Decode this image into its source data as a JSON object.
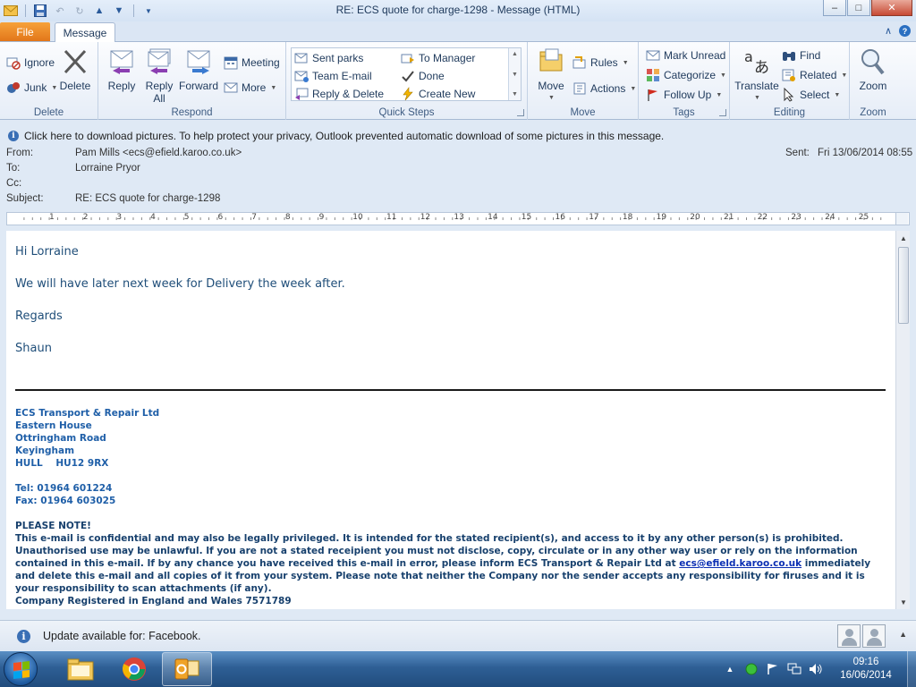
{
  "window": {
    "title": "RE: ECS quote for charge-1298  -  Message (HTML)"
  },
  "tabs": {
    "file": "File",
    "message": "Message"
  },
  "ribbon": {
    "delete_group": {
      "label": "Delete",
      "ignore": "Ignore",
      "junk": "Junk",
      "delete": "Delete"
    },
    "respond_group": {
      "label": "Respond",
      "reply": "Reply",
      "reply_all": "Reply All",
      "reply_all_line1": "Reply",
      "reply_all_line2": "All",
      "forward": "Forward",
      "meeting": "Meeting",
      "more": "More"
    },
    "quick_steps": {
      "label": "Quick Steps",
      "items": [
        "Sent parks",
        "To Manager",
        "Team E-mail",
        "Done",
        "Reply & Delete",
        "Create New"
      ]
    },
    "move_group": {
      "label": "Move",
      "move": "Move",
      "rules": "Rules",
      "actions": "Actions"
    },
    "tags_group": {
      "label": "Tags",
      "mark_unread": "Mark Unread",
      "categorize": "Categorize",
      "follow_up": "Follow Up"
    },
    "editing_group": {
      "label": "Editing",
      "translate": "Translate",
      "find": "Find",
      "related": "Related",
      "select": "Select"
    },
    "zoom_group": {
      "label": "Zoom",
      "zoom": "Zoom"
    }
  },
  "infobar": {
    "text": "Click here to download pictures. To help protect your privacy, Outlook prevented automatic download of some pictures in this message."
  },
  "header": {
    "from_label": "From:",
    "from_value": "Pam Mills <ecs@efield.karoo.co.uk>",
    "to_label": "To:",
    "to_value": "Lorraine Pryor",
    "cc_label": "Cc:",
    "cc_value": "",
    "subject_label": "Subject:",
    "subject_value": "RE: ECS quote for charge-1298",
    "sent_label": "Sent:",
    "sent_value": "Fri 13/06/2014 08:55"
  },
  "ruler": {
    "numbers": [
      "1",
      "2",
      "3",
      "4",
      "5",
      "6",
      "7",
      "8",
      "9",
      "10",
      "11",
      "12",
      "13",
      "14",
      "15",
      "16",
      "17",
      "18",
      "19",
      "20",
      "21",
      "22",
      "23",
      "24",
      "25"
    ]
  },
  "body": {
    "greeting": "Hi Lorraine",
    "line1": "We will have later next week for Delivery the week after.",
    "regards": "Regards",
    "name": "Shaun"
  },
  "signature": {
    "company": "ECS Transport & Repair Ltd",
    "address1": "Eastern House",
    "address2": "Ottringham Road",
    "address3": "Keyingham",
    "address4": "HULL    HU12 9RX",
    "tel": "Tel: 01964 601224",
    "fax": "Fax: 01964 603025",
    "note_heading": "PLEASE NOTE!",
    "disclaimer_part1": "This e-mail is confidential and may also be legally privileged.  It is intended for the stated recipient(s), and access to it by any other person(s) is prohibited.  Unauthorised use may be unlawful.  If you are not a stated receipient you must not disclose, copy, circulate or in any other way user or rely on the information contained in this e-mail.  If by any chance you have received this e-mail in error, please inform ECS Transport & Repair Ltd at ",
    "disclaimer_email": "ecs@efield.karoo.co.uk",
    "disclaimer_part2": " immediately and delete this e-mail and all copies of it from your system.  Please note that neither the Company nor the sender accepts any responsibility for firuses and it is your responsibility to scan attachments (if any).",
    "registered": "Company Registered in England and Wales 7571789"
  },
  "social_bar": {
    "update_text": "Update available for: Facebook."
  },
  "taskbar": {
    "time": "09:16",
    "date": "16/06/2014"
  },
  "colors": {
    "accent_blue": "#1f4e79",
    "signature_blue": "#1f5fa8",
    "file_tab_orange": "#e2761a",
    "taskbar_blue": "#2e5f95"
  }
}
